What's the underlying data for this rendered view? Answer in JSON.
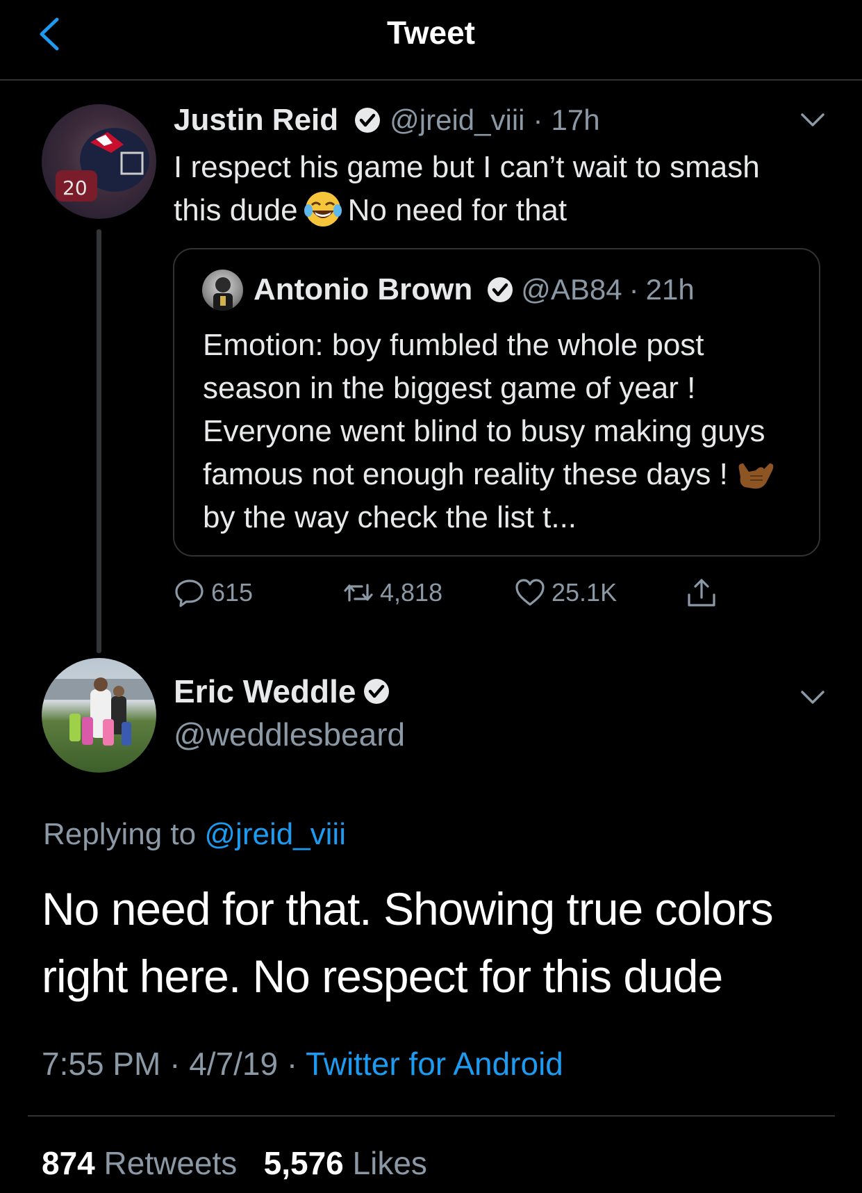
{
  "header": {
    "title": "Tweet",
    "back_icon": "chevron-left-icon"
  },
  "colors": {
    "background": "#000000",
    "link": "#1d9bf0",
    "muted": "#8b98a5",
    "text": "#e7e9ea"
  },
  "parent_tweet": {
    "name": "Justin Reid",
    "handle": "@jreid_viii",
    "sep": "·",
    "time": "17h",
    "text_part1": "I respect his game but I can’t wait to smash this dude",
    "emoji": "face-with-tears-of-joy",
    "text_part2": "No need for that",
    "quoted": {
      "name": "Antonio Brown",
      "handle": "@AB84",
      "sep": "·",
      "time": "21h",
      "text_part1": "Emotion: boy fumbled the whole post season in the biggest game of year ! Everyone went blind to busy making guys famous not enough reality these days !",
      "emoji": "call-me-hand",
      "text_part2": "by the way check the list t..."
    },
    "actions": {
      "replies": "615",
      "retweets": "4,818",
      "likes": "25.1K"
    }
  },
  "reply_tweet": {
    "name": "Eric Weddle",
    "handle": "@weddlesbeard",
    "replying_prefix": "Replying to",
    "replying_to": "@jreid_viii",
    "text": "No need for that. Showing true colors right here. No respect for this dude",
    "time": "7:55 PM",
    "date": "4/7/19",
    "sep": "·",
    "source": "Twitter for Android",
    "retweets_count": "874",
    "retweets_label": "Retweets",
    "likes_count": "5,576",
    "likes_label": "Likes"
  }
}
